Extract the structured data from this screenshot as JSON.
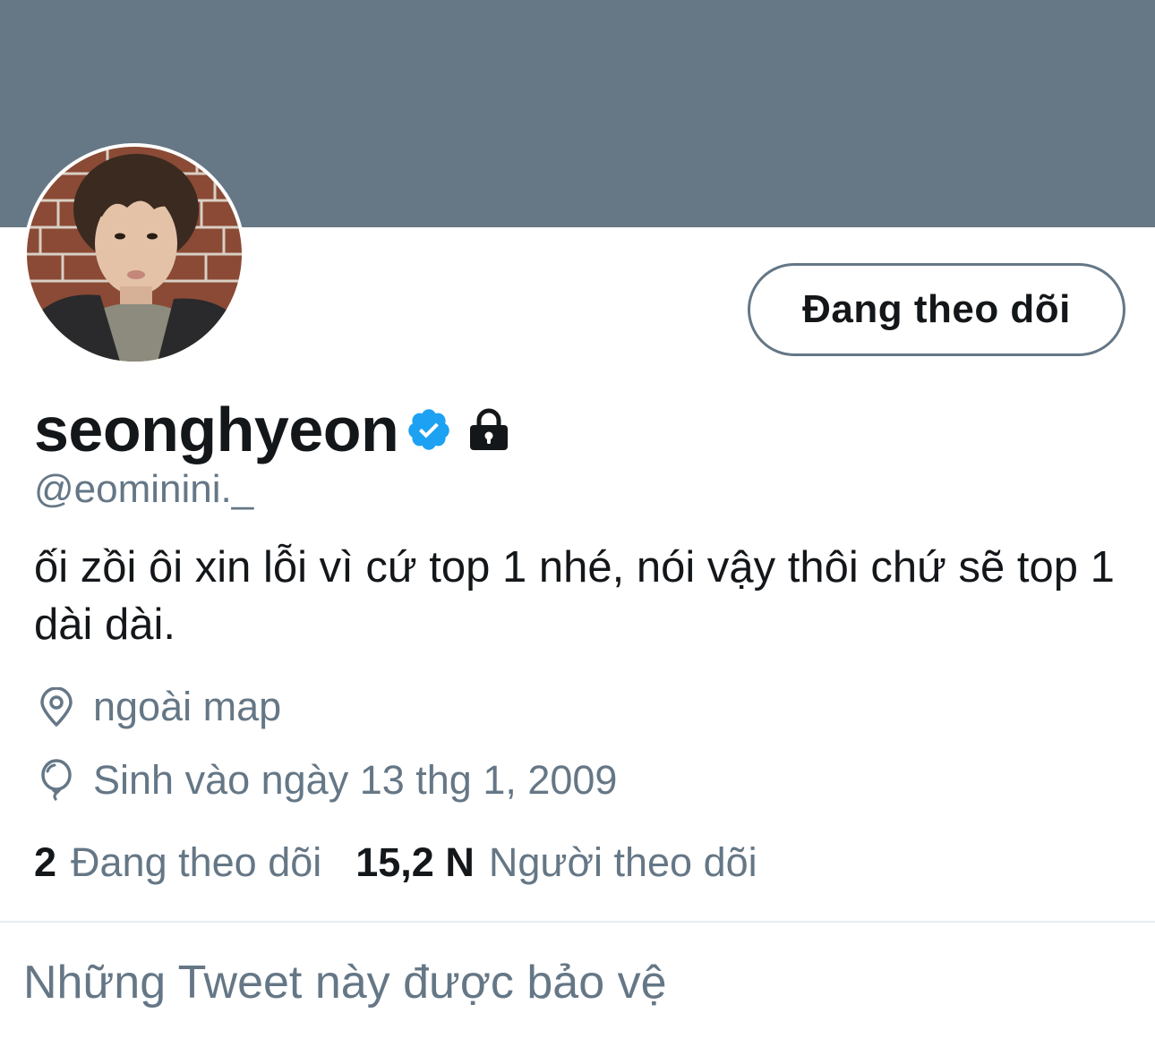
{
  "profile": {
    "display_name": "seonghyeon",
    "handle": "@eominini._",
    "bio": "ối zồi ôi xin lỗi vì cứ top 1 nhé, nói vậy thôi chứ sẽ top 1 dài dài.",
    "location": "ngoài map",
    "birthday": "Sinh vào ngày 13 thg 1, 2009",
    "verified": true,
    "protected": true
  },
  "actions": {
    "follow_button_label": "Đang theo dõi"
  },
  "stats": {
    "following_count": "2",
    "following_label": "Đang theo dõi",
    "followers_count": "15,2 N",
    "followers_label": "Người theo dõi"
  },
  "protected_notice": "Những Tweet này được bảo vệ",
  "icons": {
    "verified": "verified-badge-icon",
    "lock": "lock-icon",
    "location": "location-pin-icon",
    "birthday": "balloon-icon"
  },
  "colors": {
    "banner": "#667786",
    "verified": "#1da1f2",
    "secondary_text": "#657786",
    "primary_text": "#14171a"
  }
}
